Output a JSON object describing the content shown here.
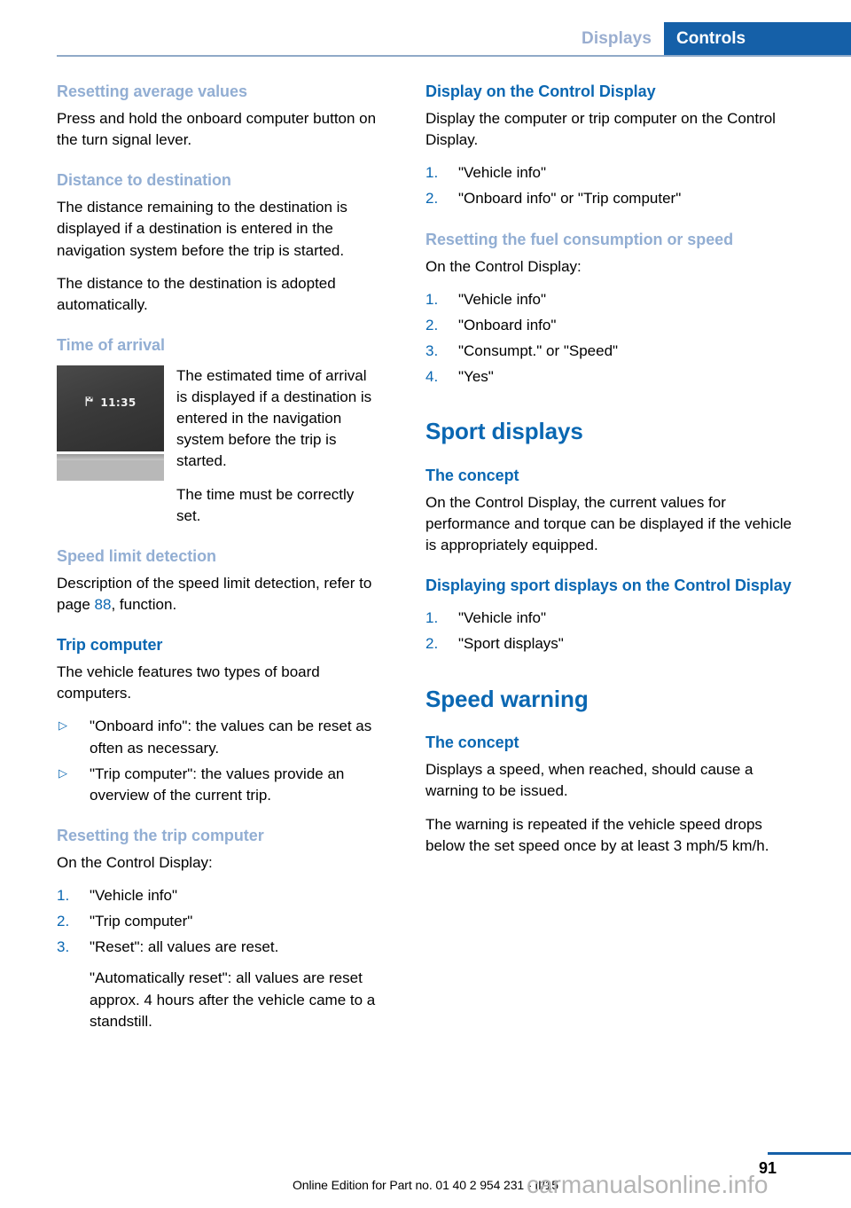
{
  "header": {
    "tab_inactive": "Displays",
    "tab_active": "Controls",
    "accent_blue": "#1560a8",
    "muted_blue": "#9aaed0"
  },
  "colors": {
    "heading_major": "#0a67b2",
    "heading_sub": "#0a67b2",
    "heading_light": "#92aed3",
    "marker_blue": "#0a67b2",
    "rule_blue": "#8fa9c8",
    "watermark_gray": "#b4b4b4"
  },
  "left_column": {
    "s1": {
      "heading": "Resetting average values",
      "p1": "Press and hold the onboard computer button on the turn signal lever."
    },
    "s2": {
      "heading": "Distance to destination",
      "p1": "The distance remaining to the destination is displayed if a destination is entered in the navigation system before the trip is started.",
      "p2": "The distance to the destination is adopted automatically."
    },
    "s3": {
      "heading": "Time of arrival",
      "figure": {
        "icon_name": "checkered-flag-icon",
        "readout_time": "11:35"
      },
      "p1": "The estimated time of arrival is displayed if a destination is entered in the navigation system before the trip is started.",
      "p2": "The time must be correctly set."
    },
    "s4": {
      "heading": "Speed limit detection",
      "p1_before": "Description of the speed limit detection, refer to page ",
      "p1_pageref": "88",
      "p1_after": ", function."
    },
    "s5": {
      "heading": "Trip computer",
      "p1": "The vehicle features two types of board computers.",
      "bullets": [
        {
          "marker": "▷",
          "text": "\"Onboard info\": the values can be reset as often as necessary."
        },
        {
          "marker": "▷",
          "text": "\"Trip computer\": the values provide an overview of the current trip."
        }
      ]
    },
    "s6": {
      "heading": "Resetting the trip computer",
      "p1": "On the Control Display:",
      "steps": [
        {
          "marker": "1.",
          "text": "\"Vehicle info\""
        },
        {
          "marker": "2.",
          "text": "\"Trip computer\""
        },
        {
          "marker": "3.",
          "text": "\"Reset\": all values are reset."
        }
      ],
      "step3_extra": "\"Automatically reset\": all values are reset approx. 4 hours after the vehicle came to a standstill."
    }
  },
  "right_column": {
    "s1": {
      "heading": "Display on the Control Display",
      "p1": "Display the computer or trip computer on the Control Display.",
      "steps": [
        {
          "marker": "1.",
          "text": "\"Vehicle info\""
        },
        {
          "marker": "2.",
          "text": "\"Onboard info\" or \"Trip computer\""
        }
      ]
    },
    "s2": {
      "heading": "Resetting the fuel consumption or speed",
      "p1": "On the Control Display:",
      "steps": [
        {
          "marker": "1.",
          "text": "\"Vehicle info\""
        },
        {
          "marker": "2.",
          "text": "\"Onboard info\""
        },
        {
          "marker": "3.",
          "text": "\"Consumpt.\" or \"Speed\""
        },
        {
          "marker": "4.",
          "text": "\"Yes\""
        }
      ]
    },
    "s3": {
      "title": "Sport displays",
      "sub1": {
        "heading": "The concept",
        "p1": "On the Control Display, the current values for performance and torque can be displayed if the vehicle is appropriately equipped."
      },
      "sub2": {
        "heading": "Displaying sport displays on the Control Display",
        "steps": [
          {
            "marker": "1.",
            "text": "\"Vehicle info\""
          },
          {
            "marker": "2.",
            "text": "\"Sport displays\""
          }
        ]
      }
    },
    "s4": {
      "title": "Speed warning",
      "sub1": {
        "heading": "The concept",
        "p1": "Displays a speed, when reached, should cause a warning to be issued.",
        "p2": "The warning is repeated if the vehicle speed drops below the set speed once by at least 3 mph/5 km/h."
      }
    }
  },
  "footer": {
    "page_number": "91",
    "edition": "Online Edition for Part no. 01 40 2 954 231 - II/15",
    "watermark": "carmanualsonline.info"
  }
}
